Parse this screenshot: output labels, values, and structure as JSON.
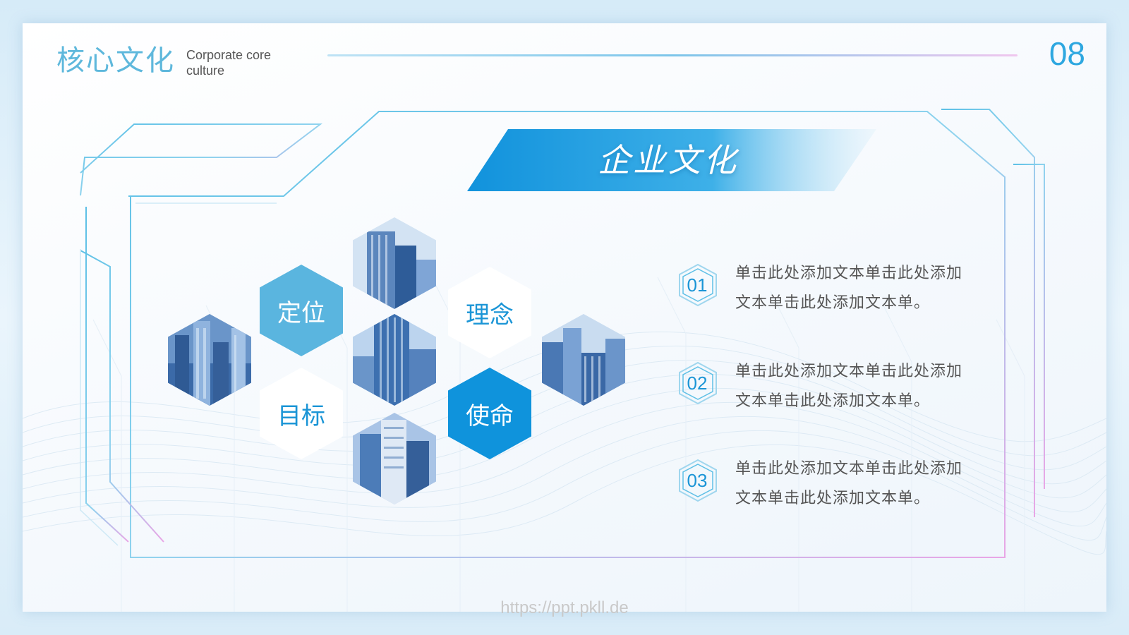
{
  "header": {
    "title_cn": "核心文化",
    "title_en": "Corporate core culture",
    "page_number": "08"
  },
  "banner": {
    "title": "企业文化"
  },
  "hexagons": {
    "positioning": "定位",
    "philosophy": "理念",
    "goal": "目标",
    "mission": "使命"
  },
  "items": [
    {
      "number": "01",
      "text": "单击此处添加文本单击此处添加文本单击此处添加文本单。"
    },
    {
      "number": "02",
      "text": "单击此处添加文本单击此处添加文本单击此处添加文本单。"
    },
    {
      "number": "03",
      "text": "单击此处添加文本单击此处添加文本单击此处添加文本单。"
    }
  ],
  "watermark": "https://ppt.pkll.de",
  "colors": {
    "accent": "#1b95d6",
    "light_accent": "#5fb8dc",
    "frame": "#7ccbe8",
    "pink": "#e9a6e6"
  }
}
